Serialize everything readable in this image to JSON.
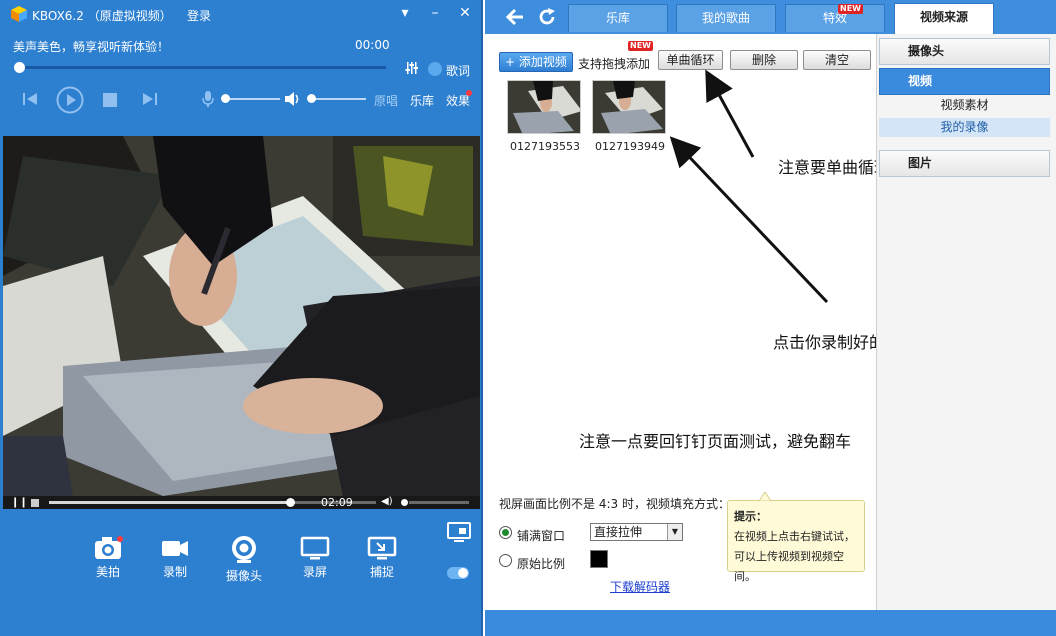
{
  "player": {
    "app_title": "KBOX6.2 （原虚拟视频）",
    "login": "登录",
    "slogan": "美声美色，畅享视听新体验！",
    "time": "00:00",
    "lyrics": "歌词",
    "original": "原唱",
    "library": "乐库",
    "effects": "效果",
    "video_time": "02:09",
    "tools": [
      {
        "label": "美拍",
        "icon": "camera-icon"
      },
      {
        "label": "录制",
        "icon": "video-camera-icon"
      },
      {
        "label": "摄像头",
        "icon": "webcam-icon"
      },
      {
        "label": "录屏",
        "icon": "monitor-icon"
      },
      {
        "label": "捕捉",
        "icon": "capture-icon"
      }
    ]
  },
  "tabs": [
    {
      "label": "乐库"
    },
    {
      "label": "我的歌曲"
    },
    {
      "label": "特效",
      "badge": "NEW"
    },
    {
      "label": "视频来源"
    }
  ],
  "toolbar": {
    "add_video": "添加视频",
    "drag_hint": "支持拖拽添加",
    "new_badge": "NEW",
    "loop": "单曲循环",
    "delete": "删除",
    "clear": "清空"
  },
  "videos": [
    {
      "name": "0127193553"
    },
    {
      "name": "0127193949"
    }
  ],
  "annotations": {
    "loop_note": "注意要单曲循环",
    "click_note": "点击你录制好的视频",
    "test_note": "注意一点要回钉钉页面测试，避免翻车"
  },
  "settings": {
    "ratio_label": "视屏画面比例不是 4:3 时，视频填充方式：",
    "fill_window": "铺满窗口",
    "original_ratio": "原始比例",
    "stretch": "直接拉伸",
    "download_codec": "下载解码器"
  },
  "tip": {
    "title": "提示：",
    "line1": "在视频上点击右键试试，",
    "line2": "可以上传视频到视频空间。"
  },
  "sidebar": {
    "camera": "摄像头",
    "video": "视频",
    "video_material": "视频素材",
    "my_recordings": "我的录像",
    "pictures": "图片"
  },
  "colors": {
    "player_blue": "#2d7fd0",
    "topbar_blue": "#3f8ede",
    "accent_red": "#ff3b3b"
  }
}
